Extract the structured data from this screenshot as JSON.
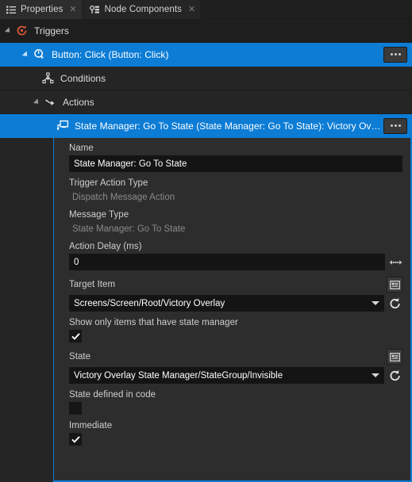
{
  "tabs": [
    {
      "label": "Properties",
      "icon": "list-icon",
      "active": true,
      "close": "✕"
    },
    {
      "label": "Node Components",
      "icon": "node-components-icon",
      "active": false,
      "close": "✕"
    }
  ],
  "tree": [
    {
      "label": "Triggers",
      "icon": "trigger-icon",
      "indent": 8,
      "twisty": true,
      "selected": false,
      "menu": false
    },
    {
      "label": "Button: Click (Button: Click)",
      "icon": "click-event-icon",
      "indent": 30,
      "twisty": true,
      "selected": true,
      "menu": true
    },
    {
      "label": "Conditions",
      "icon": "conditions-icon",
      "indent": 52,
      "twisty": false,
      "selected": false,
      "menu": false
    },
    {
      "label": "Actions",
      "icon": "actions-arrow-icon",
      "indent": 44,
      "twisty": true,
      "selected": false,
      "menu": false
    },
    {
      "label": "State Manager: Go To State (State Manager: Go To State): Victory Overlay",
      "icon": "message-action-icon",
      "indent": 70,
      "twisty": false,
      "selected": true,
      "menu": true
    }
  ],
  "menu_button_label": "•••",
  "form": {
    "name": {
      "label": "Name",
      "value": "State Manager: Go To State"
    },
    "trigger_action_type": {
      "label": "Trigger Action Type",
      "value": "Dispatch Message Action"
    },
    "message_type": {
      "label": "Message Type",
      "value": "State Manager: Go To State"
    },
    "action_delay": {
      "label": "Action Delay (ms)",
      "value": "0"
    },
    "target_item": {
      "label": "Target Item",
      "value": "Screens/Screen/Root/Victory Overlay"
    },
    "show_only_state_manager": {
      "label": "Show only items that have state manager",
      "checked": true
    },
    "state": {
      "label": "State",
      "value": "Victory Overlay State Manager/StateGroup/Invisible"
    },
    "state_defined_in_code": {
      "label": "State defined in code",
      "checked": false
    },
    "immediate": {
      "label": "Immediate",
      "checked": true
    }
  },
  "colors": {
    "selection_blue": "#0c7cd5",
    "panel_bg": "#2d2d2d",
    "tree_bg": "#252525",
    "input_bg": "#141414",
    "trigger_icon_red": "#e05a3a"
  }
}
